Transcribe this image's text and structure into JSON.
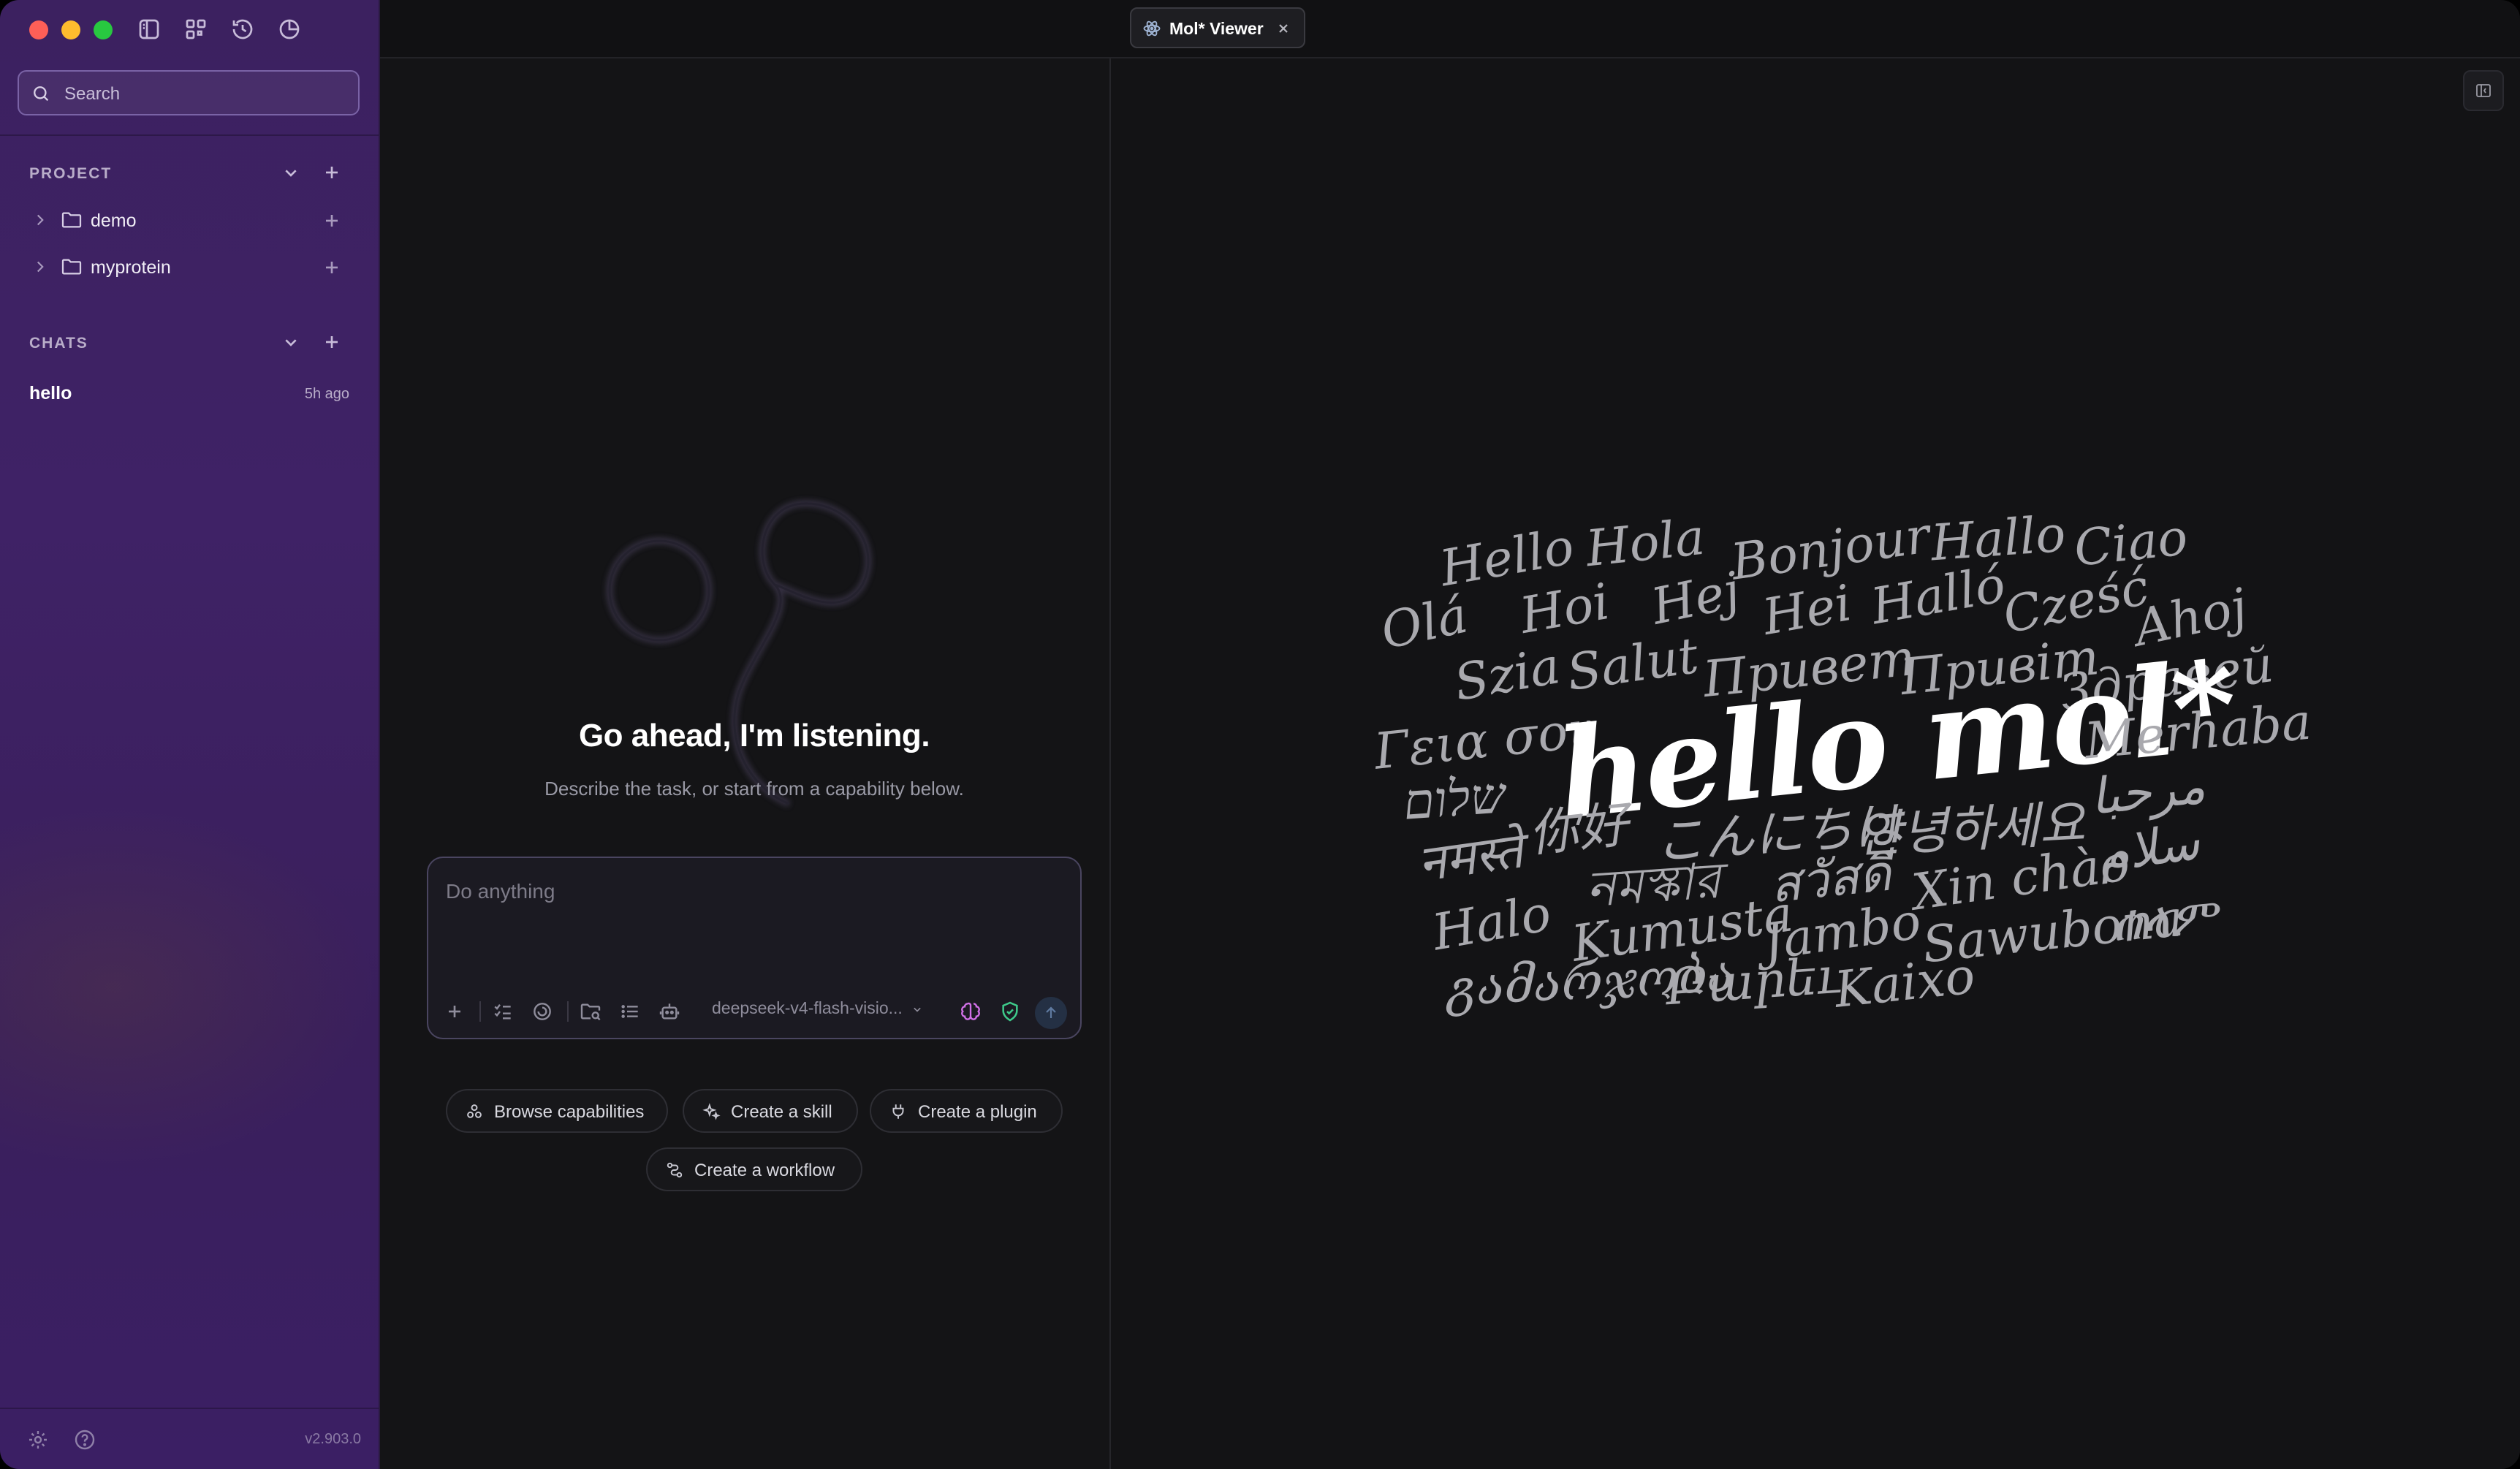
{
  "window": {
    "traffic_lights": [
      "#fe5f57",
      "#febc2e",
      "#28c840"
    ],
    "toolbar_icons": [
      "sidebar-toggle-icon",
      "grid-icon",
      "history-icon",
      "clock-icon"
    ]
  },
  "sidebar": {
    "search_placeholder": "Search",
    "project": {
      "title": "PROJECT",
      "items": [
        {
          "label": "demo"
        },
        {
          "label": "myprotein"
        }
      ]
    },
    "chats": {
      "title": "CHATS",
      "items": [
        {
          "label": "hello",
          "time": "5h ago"
        }
      ]
    },
    "version": "v2.903.0"
  },
  "tabs": [
    {
      "label": "Mol* Viewer",
      "active": true
    }
  ],
  "chat": {
    "title": "Go ahead, I'm listening.",
    "subtitle": "Describe the task, or start from a capability below.",
    "input_placeholder": "Do anything",
    "model": "deepseek-v4-flash-visio...",
    "chips": [
      {
        "label": "Browse capabilities"
      },
      {
        "label": "Create a skill"
      },
      {
        "label": "Create a plugin"
      },
      {
        "label": "Create a workflow"
      }
    ]
  },
  "viewer": {
    "greeting": "hello mol*",
    "words": [
      "Hello",
      "Hola",
      "Bonjour",
      "Hallo",
      "Ciao",
      "Olá",
      "Hoi",
      "Hej",
      "Hei",
      "Halló",
      "Cześć",
      "Ahoj",
      "Szia",
      "Salut",
      "Привет",
      "Привіт",
      "Здравей",
      "Γεια σου",
      "Merhaba",
      "שלום",
      "مرحبا",
      "नमस्ते",
      "你好",
      "こんにちは",
      "안녕하세요",
      "سلام",
      "নমস্কার",
      "สวัสดี",
      "Xin chào",
      "Halo",
      "Kumusta",
      "Jambo",
      "Sawubona",
      "ሰላም",
      "გამარჯობა",
      "Բարեւ",
      "Kaixo"
    ]
  },
  "colors": {
    "accent": "#7a63a6",
    "sidebar_bg": "#3f2266",
    "send_button": "#243044"
  }
}
